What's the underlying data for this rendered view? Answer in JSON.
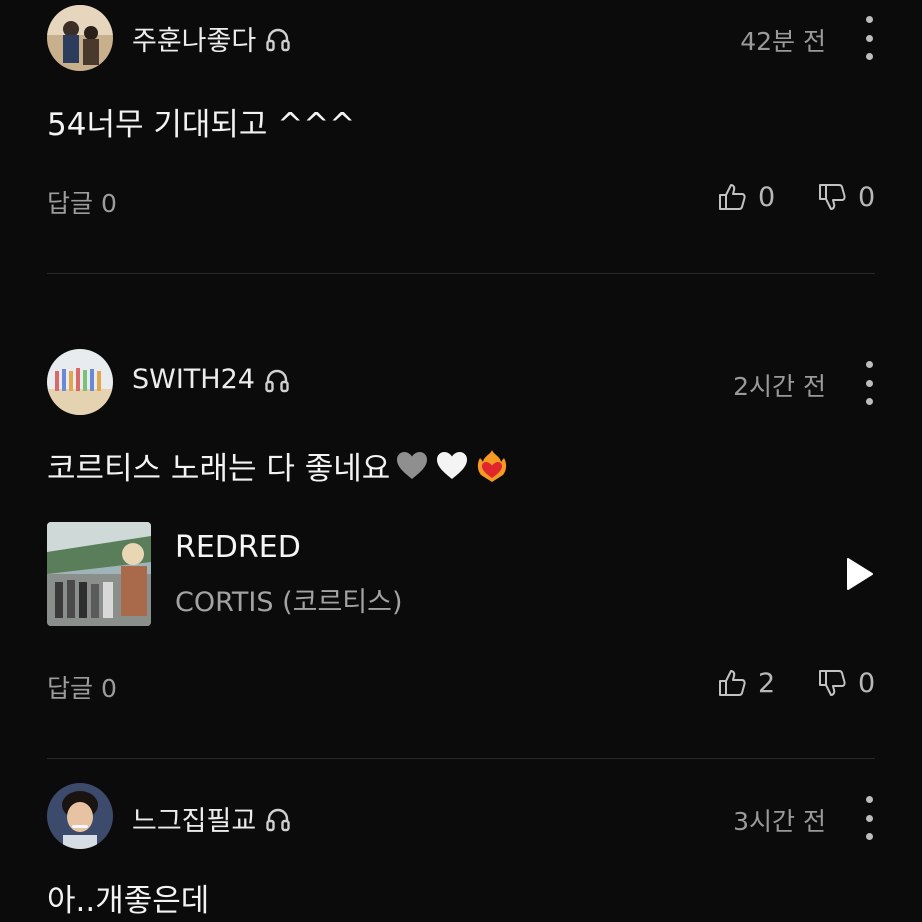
{
  "comments": [
    {
      "username": "주훈나좋다",
      "time": "42분 전",
      "content": "54너무 기대되고 ^^^",
      "reply_label": "답글 0",
      "likes": "0",
      "dislikes": "0",
      "avatar_icon": "avatar-photo",
      "badge_icon": "headphones-icon"
    },
    {
      "username": "SWITH24",
      "time": "2시간 전",
      "content": "코르티스 노래는 다 좋네요",
      "emojis": [
        "grey-heart",
        "white-heart",
        "heart-on-fire"
      ],
      "track": {
        "title": "REDRED",
        "artist": "CORTIS (코르티스)",
        "play_icon": "play-icon"
      },
      "reply_label": "답글 0",
      "likes": "2",
      "dislikes": "0",
      "avatar_icon": "avatar-photo",
      "badge_icon": "headphones-icon"
    },
    {
      "username": "느그집필교",
      "time": "3시간 전",
      "content": "아..개좋은데",
      "avatar_icon": "avatar-photo",
      "badge_icon": "headphones-icon"
    }
  ],
  "colors": {
    "background": "#0b0b0b",
    "text_primary": "#f1f1f1",
    "text_secondary": "#9a9a9a",
    "divider": "#2a2a2a"
  }
}
